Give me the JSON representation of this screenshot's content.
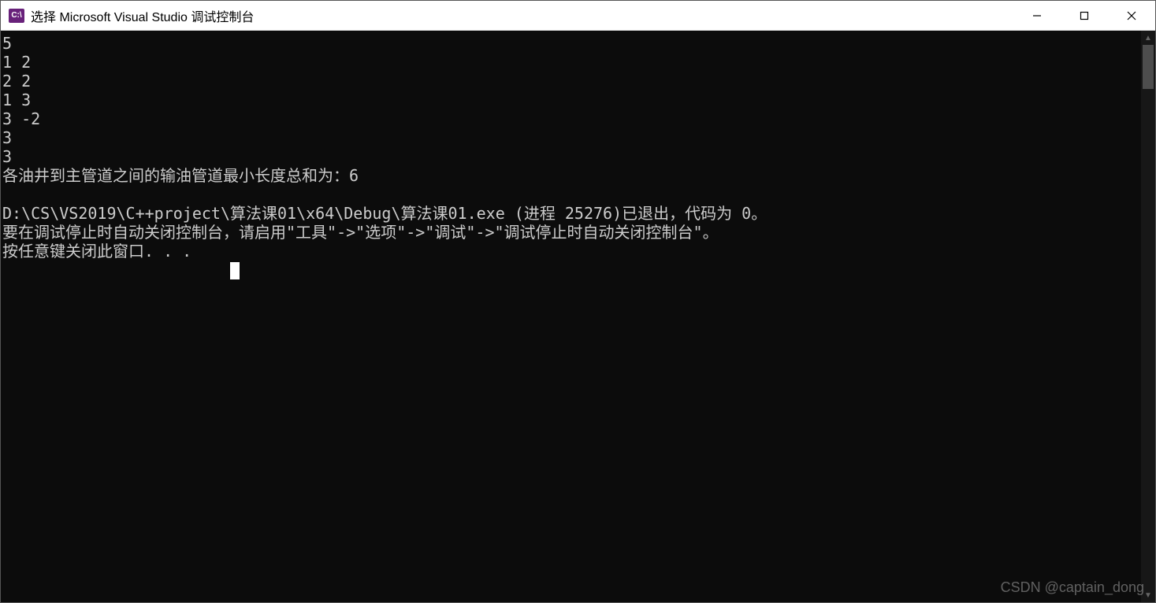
{
  "titlebar": {
    "icon_text": "C:\\",
    "title": "选择 Microsoft Visual Studio 调试控制台"
  },
  "console": {
    "lines": [
      "5",
      "1 2",
      "2 2",
      "1 3",
      "3 -2",
      "3",
      "3",
      "各油井到主管道之间的输油管道最小长度总和为：6",
      "",
      "D:\\CS\\VS2019\\C++project\\算法课01\\x64\\Debug\\算法课01.exe (进程 25276)已退出，代码为 0。",
      "要在调试停止时自动关闭控制台，请启用\"工具\"->\"选项\"->\"调试\"->\"调试停止时自动关闭控制台\"。",
      "按任意键关闭此窗口. . ."
    ],
    "cursor_prefix": "                        "
  },
  "watermark": "CSDN @captain_dong"
}
